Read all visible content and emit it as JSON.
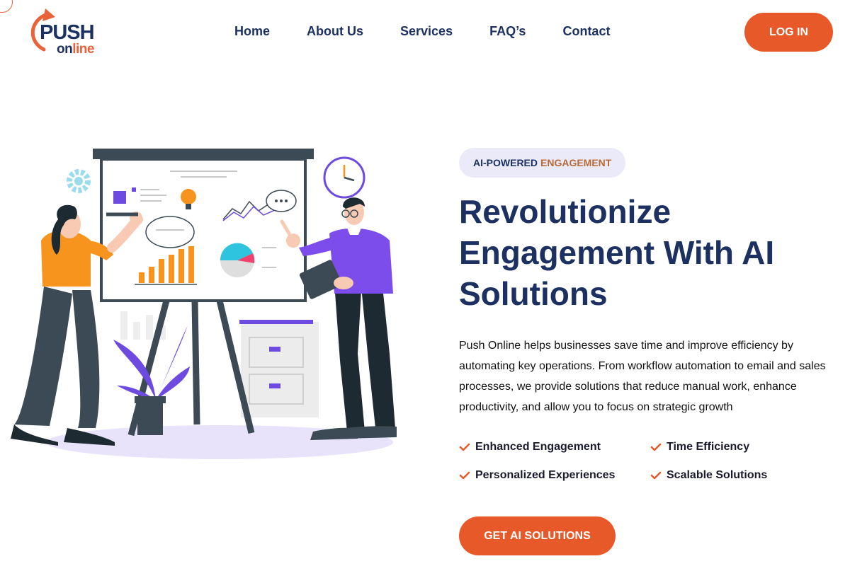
{
  "brand": {
    "name_top": "PUSH",
    "name_on": "on",
    "name_line": "line",
    "accent_color": "#e8592a",
    "primary_color": "#1c3161"
  },
  "nav": {
    "items": [
      "Home",
      "About Us",
      "Services",
      "FAQ’s",
      "Contact"
    ],
    "login_label": "LOG IN"
  },
  "hero": {
    "badge_part1": "AI-POWERED",
    "badge_part2": "ENGAGEMENT",
    "headline": "Revolutionize Engagement With AI Solutions",
    "description": "Push Online helps businesses save time and improve efficiency by automating key operations. From workflow automation to email and sales processes, we provide solutions that reduce manual work, enhance productivity, and allow you to focus on strategic growth",
    "features": [
      "Enhanced Engagement",
      "Time Efficiency",
      "Personalized Experiences",
      "Scalable Solutions"
    ],
    "cta_label": "GET AI SOLUTIONS"
  },
  "icons": {
    "feature_icon": "check-icon",
    "logo_icon": "curved-arrow-icon"
  }
}
